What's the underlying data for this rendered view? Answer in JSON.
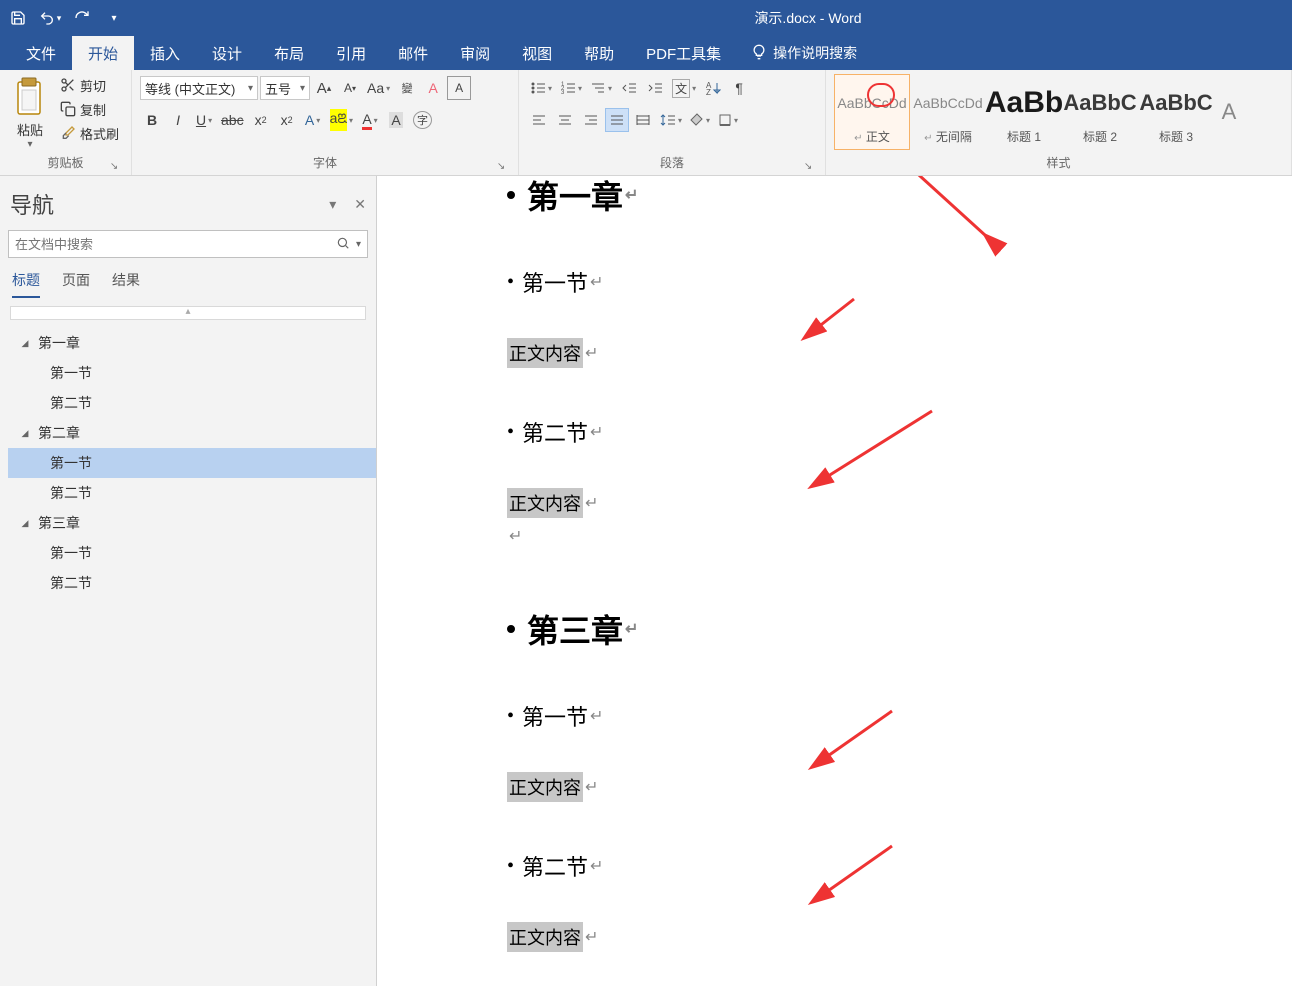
{
  "title": "演示.docx - Word",
  "quick_access": {
    "save": "保存",
    "undo": "撤销",
    "redo": "重复"
  },
  "tabs": {
    "file": "文件",
    "home": "开始",
    "insert": "插入",
    "design": "设计",
    "layout": "布局",
    "references": "引用",
    "mailings": "邮件",
    "review": "审阅",
    "view": "视图",
    "help": "帮助",
    "pdf": "PDF工具集",
    "tell_me": "操作说明搜索"
  },
  "ribbon": {
    "clipboard": {
      "paste": "粘贴",
      "cut": "剪切",
      "copy": "复制",
      "format_painter": "格式刷",
      "group_label": "剪贴板"
    },
    "font": {
      "name": "等线 (中文正文)",
      "size": "五号",
      "group_label": "字体"
    },
    "paragraph": {
      "group_label": "段落"
    },
    "styles": {
      "group_label": "样式",
      "items": [
        {
          "preview": "AaBbCcDd",
          "name": "正文",
          "active": true
        },
        {
          "preview": "AaBbCcDd",
          "name": "无间隔"
        },
        {
          "preview": "AaBb",
          "name": "标题 1"
        },
        {
          "preview": "AaBbC",
          "name": "标题 2"
        },
        {
          "preview": "AaBbC",
          "name": "标题 3"
        },
        {
          "preview": "A",
          "name": ""
        }
      ]
    }
  },
  "navigation": {
    "title": "导航",
    "search_placeholder": "在文档中搜索",
    "tabs": {
      "headings": "标题",
      "pages": "页面",
      "results": "结果"
    },
    "tree": [
      {
        "label": "第一章",
        "expanded": true,
        "children": [
          {
            "label": "第一节"
          },
          {
            "label": "第二节"
          }
        ]
      },
      {
        "label": "第二章",
        "expanded": true,
        "children": [
          {
            "label": "第一节",
            "selected": true
          },
          {
            "label": "第二节"
          }
        ]
      },
      {
        "label": "第三章",
        "expanded": true,
        "children": [
          {
            "label": "第一节"
          },
          {
            "label": "第二节"
          }
        ]
      }
    ]
  },
  "document": {
    "lines": [
      {
        "type": "chapter-top",
        "text": "第一章"
      },
      {
        "type": "section",
        "text": "第一节"
      },
      {
        "type": "body",
        "text": "正文内容"
      },
      {
        "type": "section",
        "text": "第二节"
      },
      {
        "type": "body",
        "text": "正文内容"
      },
      {
        "type": "empty"
      },
      {
        "type": "chapter",
        "text": "第三章"
      },
      {
        "type": "section",
        "text": "第一节"
      },
      {
        "type": "body",
        "text": "正文内容"
      },
      {
        "type": "section",
        "text": "第二节"
      },
      {
        "type": "body",
        "text": "正文内容"
      }
    ]
  }
}
